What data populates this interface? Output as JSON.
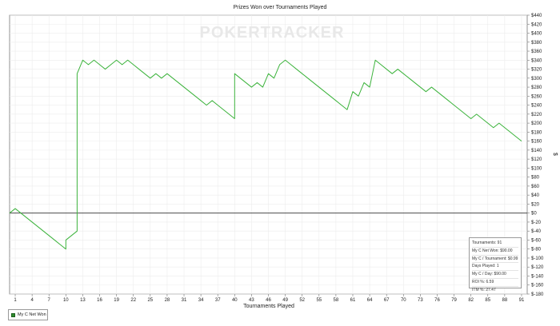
{
  "chart_data": {
    "type": "line",
    "title": "Prizes Won over Tournaments Played",
    "xlabel": "Tournaments Played",
    "ylabel": "$",
    "watermark": "POKERTRACKER",
    "x_ticks": [
      1,
      4,
      7,
      10,
      13,
      16,
      19,
      22,
      25,
      28,
      31,
      34,
      37,
      40,
      43,
      46,
      49,
      52,
      55,
      58,
      61,
      64,
      67,
      70,
      73,
      76,
      79,
      82,
      85,
      88,
      91
    ],
    "y_ticks": [
      440,
      420,
      400,
      380,
      360,
      340,
      320,
      300,
      280,
      260,
      240,
      220,
      200,
      180,
      160,
      140,
      120,
      100,
      80,
      60,
      40,
      20,
      0,
      -20,
      -40,
      -60,
      -80,
      -100,
      -120,
      -140,
      -160,
      -180
    ],
    "y_tick_labels": [
      "$440",
      "$420",
      "$400",
      "$380",
      "$360",
      "$340",
      "$320",
      "$300",
      "$280",
      "$260",
      "$240",
      "$220",
      "$200",
      "$180",
      "$160",
      "$140",
      "$120",
      "$100",
      "$80",
      "$60",
      "$40",
      "$20",
      "$0",
      "$-20",
      "$-40",
      "$-60",
      "$-80",
      "$-100",
      "$-120",
      "$-140",
      "$-160",
      "$-180"
    ],
    "xlim": [
      0,
      92
    ],
    "ylim": [
      -180,
      440
    ],
    "grid": true,
    "legend_position": "bottom-left",
    "series": [
      {
        "name": "My C Net Won",
        "color": "#3cb33c",
        "points": [
          [
            0,
            0
          ],
          [
            1,
            10
          ],
          [
            2,
            0
          ],
          [
            3,
            -10
          ],
          [
            4,
            -20
          ],
          [
            5,
            -30
          ],
          [
            6,
            -40
          ],
          [
            7,
            -50
          ],
          [
            8,
            -60
          ],
          [
            9,
            -70
          ],
          [
            10,
            -80
          ],
          [
            10,
            -60
          ],
          [
            11,
            -50
          ],
          [
            12,
            -40
          ],
          [
            12,
            310
          ],
          [
            13,
            340
          ],
          [
            14,
            330
          ],
          [
            15,
            340
          ],
          [
            16,
            330
          ],
          [
            17,
            320
          ],
          [
            18,
            330
          ],
          [
            19,
            340
          ],
          [
            20,
            330
          ],
          [
            21,
            340
          ],
          [
            22,
            330
          ],
          [
            23,
            320
          ],
          [
            24,
            310
          ],
          [
            25,
            300
          ],
          [
            26,
            310
          ],
          [
            27,
            300
          ],
          [
            28,
            310
          ],
          [
            29,
            300
          ],
          [
            30,
            290
          ],
          [
            31,
            280
          ],
          [
            32,
            270
          ],
          [
            33,
            260
          ],
          [
            34,
            250
          ],
          [
            35,
            240
          ],
          [
            36,
            250
          ],
          [
            37,
            240
          ],
          [
            38,
            230
          ],
          [
            39,
            220
          ],
          [
            40,
            210
          ],
          [
            40,
            310
          ],
          [
            41,
            300
          ],
          [
            42,
            290
          ],
          [
            43,
            280
          ],
          [
            44,
            290
          ],
          [
            45,
            280
          ],
          [
            46,
            310
          ],
          [
            47,
            300
          ],
          [
            48,
            330
          ],
          [
            49,
            340
          ],
          [
            50,
            330
          ],
          [
            51,
            320
          ],
          [
            52,
            310
          ],
          [
            53,
            300
          ],
          [
            54,
            290
          ],
          [
            55,
            280
          ],
          [
            56,
            270
          ],
          [
            57,
            260
          ],
          [
            58,
            250
          ],
          [
            59,
            240
          ],
          [
            60,
            230
          ],
          [
            61,
            270
          ],
          [
            62,
            260
          ],
          [
            63,
            290
          ],
          [
            64,
            280
          ],
          [
            65,
            340
          ],
          [
            66,
            330
          ],
          [
            67,
            320
          ],
          [
            68,
            310
          ],
          [
            69,
            320
          ],
          [
            70,
            310
          ],
          [
            71,
            300
          ],
          [
            72,
            290
          ],
          [
            73,
            280
          ],
          [
            74,
            270
          ],
          [
            75,
            280
          ],
          [
            76,
            270
          ],
          [
            77,
            260
          ],
          [
            78,
            250
          ],
          [
            79,
            240
          ],
          [
            80,
            230
          ],
          [
            81,
            220
          ],
          [
            82,
            210
          ],
          [
            83,
            220
          ],
          [
            84,
            210
          ],
          [
            85,
            200
          ],
          [
            86,
            190
          ],
          [
            87,
            200
          ],
          [
            88,
            190
          ],
          [
            89,
            180
          ],
          [
            90,
            170
          ],
          [
            91,
            160
          ]
        ]
      }
    ],
    "stats": [
      "Tournaments: 91",
      "My C Net Won: $90.00",
      "My C / Tournament: $0.99",
      "Days Played: 1",
      "My C / Day: $90.00",
      "ROI %: 6.59",
      "ITM %: 27.47"
    ]
  }
}
